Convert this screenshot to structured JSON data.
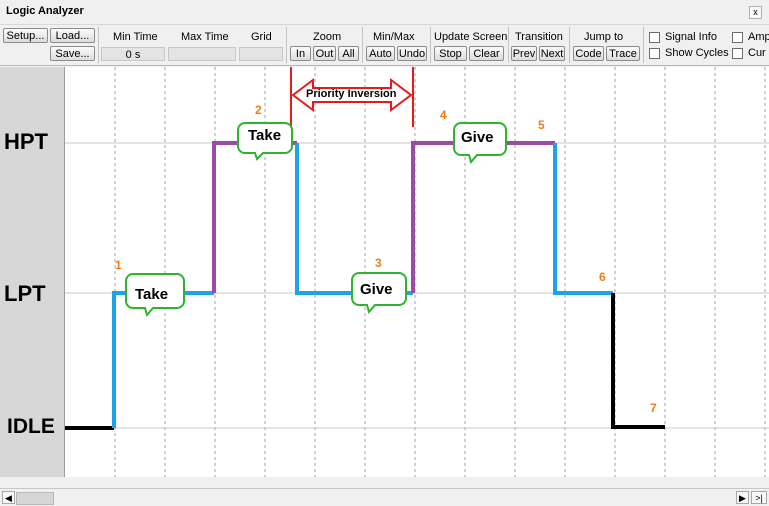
{
  "window": {
    "title": "Logic Analyzer",
    "close_glyph": "x"
  },
  "toolbar": {
    "setup": "Setup...",
    "load": "Load...",
    "save": "Save...",
    "min_time_label": "Min Time",
    "min_time_value": "0 s",
    "max_time_label": "Max Time",
    "max_time_value": "",
    "grid_label": "Grid",
    "grid_value": "",
    "zoom_label": "Zoom",
    "zoom_in": "In",
    "zoom_out": "Out",
    "zoom_all": "All",
    "minmax_label": "Min/Max",
    "auto": "Auto",
    "undo": "Undo",
    "update_label": "Update Screen",
    "stop": "Stop",
    "clear": "Clear",
    "transition_label": "Transition",
    "prev": "Prev",
    "next": "Next",
    "jump_label": "Jump to",
    "code": "Code",
    "trace": "Trace",
    "signal_info": "Signal Info",
    "show_cycles": "Show Cycles",
    "amp": "Amp",
    "cur": "Cur"
  },
  "signals": {
    "hpt": "HPT",
    "lpt": "LPT",
    "idle": "IDLE"
  },
  "annotations": {
    "priority_inversion": "Priority Inversion",
    "take_1": "Take",
    "take_2": "Take",
    "give_3": "Give",
    "give_4": "Give",
    "n1": "1",
    "n2": "2",
    "n3": "3",
    "n4": "4",
    "n5": "5",
    "n6": "6",
    "n7": "7"
  },
  "colors": {
    "lpt_trace": "#1ca3e8",
    "hpt_trace": "#9b4aa6",
    "idle_trace": "#000000",
    "callout_border": "#2db32d",
    "inversion_arrow": "#e51b1b",
    "step_number": "#f07d1a"
  },
  "scrollbar": {
    "left_glyph": "◀",
    "right_glyph": "▶",
    "end_glyph": ">|"
  }
}
